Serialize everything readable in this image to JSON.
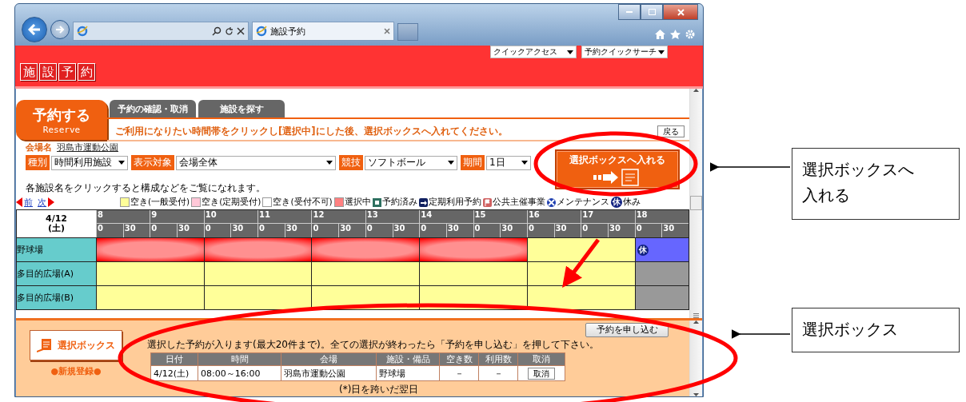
{
  "browser": {
    "tab_title": "施設予約"
  },
  "header": {
    "logo": [
      "施",
      "設",
      "予",
      "約"
    ],
    "menus": [
      {
        "label": "クイックアクセス"
      },
      {
        "label": "予約クイックサーチ"
      }
    ]
  },
  "tabs": [
    {
      "label": "予約する",
      "sublabel": "Reserve",
      "selected": true
    },
    {
      "label": "予約の確認・取消",
      "selected": false
    },
    {
      "label": "施設を探す",
      "selected": false
    }
  ],
  "instruction": "ご利用になりたい時間帯をクリックし[選択中]にした後、選択ボックスへ入れてください。",
  "back_button": "戻る",
  "venue": {
    "label": "会場名",
    "value": "羽島市運動公園"
  },
  "filters": [
    {
      "label": "種別",
      "value": "時間利用施設"
    },
    {
      "label": "表示対象",
      "value": "会場全体"
    },
    {
      "label": "競技",
      "value": "ソフトボール"
    },
    {
      "label": "期間",
      "value": "1日"
    }
  ],
  "add_button": "選択ボックスへ入れる",
  "note": "各施設名をクリックすると構成などをご覧になれます。",
  "nav": {
    "prev": "前",
    "next": "次"
  },
  "legend": [
    {
      "kind": "swatch",
      "color": "#ffff99",
      "label": "空き(一般受付)"
    },
    {
      "kind": "swatch",
      "color": "#ffc8d8",
      "label": "空き(定期受付)"
    },
    {
      "kind": "swatch",
      "color": "#ffffff",
      "label": "空き(受付不可)"
    },
    {
      "kind": "swatch",
      "color": "#ff8080",
      "label": "選択中"
    },
    {
      "kind": "booked",
      "label": "予約済み"
    },
    {
      "kind": "regular",
      "label": "定期利用予約"
    },
    {
      "kind": "event",
      "label": "公共主催事業"
    },
    {
      "kind": "maintenance",
      "label": "メンテナンス"
    },
    {
      "kind": "closed",
      "mark": "休",
      "label": "休み"
    }
  ],
  "schedule": {
    "date": "4/12",
    "weekday": "(土)",
    "hours": [
      {
        "hour": "8",
        "marks": [
          "0",
          "30"
        ]
      },
      {
        "hour": "9",
        "marks": [
          "0",
          "30"
        ]
      },
      {
        "hour": "10",
        "marks": [
          "0",
          "30"
        ]
      },
      {
        "hour": "11",
        "marks": [
          "0",
          "30"
        ]
      },
      {
        "hour": "12",
        "marks": [
          "0",
          "30"
        ]
      },
      {
        "hour": "13",
        "marks": [
          "0",
          "30"
        ]
      },
      {
        "hour": "14",
        "marks": [
          "0",
          "30"
        ]
      },
      {
        "hour": "15",
        "marks": [
          "0",
          "30"
        ]
      },
      {
        "hour": "16",
        "marks": [
          "0",
          "30"
        ]
      },
      {
        "hour": "17",
        "marks": [
          "0",
          "30"
        ]
      },
      {
        "hour": "18",
        "marks": [
          "0",
          "30"
        ]
      }
    ],
    "rows": [
      {
        "name": "野球場",
        "cells": [
          {
            "kind": "selected"
          },
          {
            "kind": "selected"
          },
          {
            "kind": "selected"
          },
          {
            "kind": "selected"
          },
          {
            "kind": "open"
          },
          {
            "kind": "closed",
            "mark": "休"
          }
        ]
      },
      {
        "name": "多目的広場(A)",
        "cells": [
          {
            "kind": "open"
          },
          {
            "kind": "open"
          },
          {
            "kind": "open"
          },
          {
            "kind": "open"
          },
          {
            "kind": "open"
          },
          {
            "kind": "unavailable"
          }
        ]
      },
      {
        "name": "多目的広場(B)",
        "cells": [
          {
            "kind": "open"
          },
          {
            "kind": "open"
          },
          {
            "kind": "open"
          },
          {
            "kind": "open"
          },
          {
            "kind": "open"
          },
          {
            "kind": "unavailable"
          }
        ]
      }
    ]
  },
  "basket": {
    "title": "選択ボックス",
    "new_link": "●新規登録●",
    "message": "選択した予約が入ります(最大20件まで)。全ての選択が終わったら「予約を申し込む」を押して下さい。",
    "columns": [
      "日付",
      "時間",
      "会場",
      "施設・備品",
      "空き数",
      "利用数",
      "取消"
    ],
    "rows": [
      {
        "cells": [
          "4/12(土)",
          "08:00～16:00",
          "羽島市運動公園",
          "野球場",
          "－",
          "－"
        ],
        "cancel": "取消"
      }
    ],
    "footnote": "(*)日を跨いだ翌日",
    "submit": "予約を申し込む"
  },
  "callouts": [
    {
      "text": "選択ボックスへ入れる"
    },
    {
      "text": "選択ボックス"
    }
  ]
}
